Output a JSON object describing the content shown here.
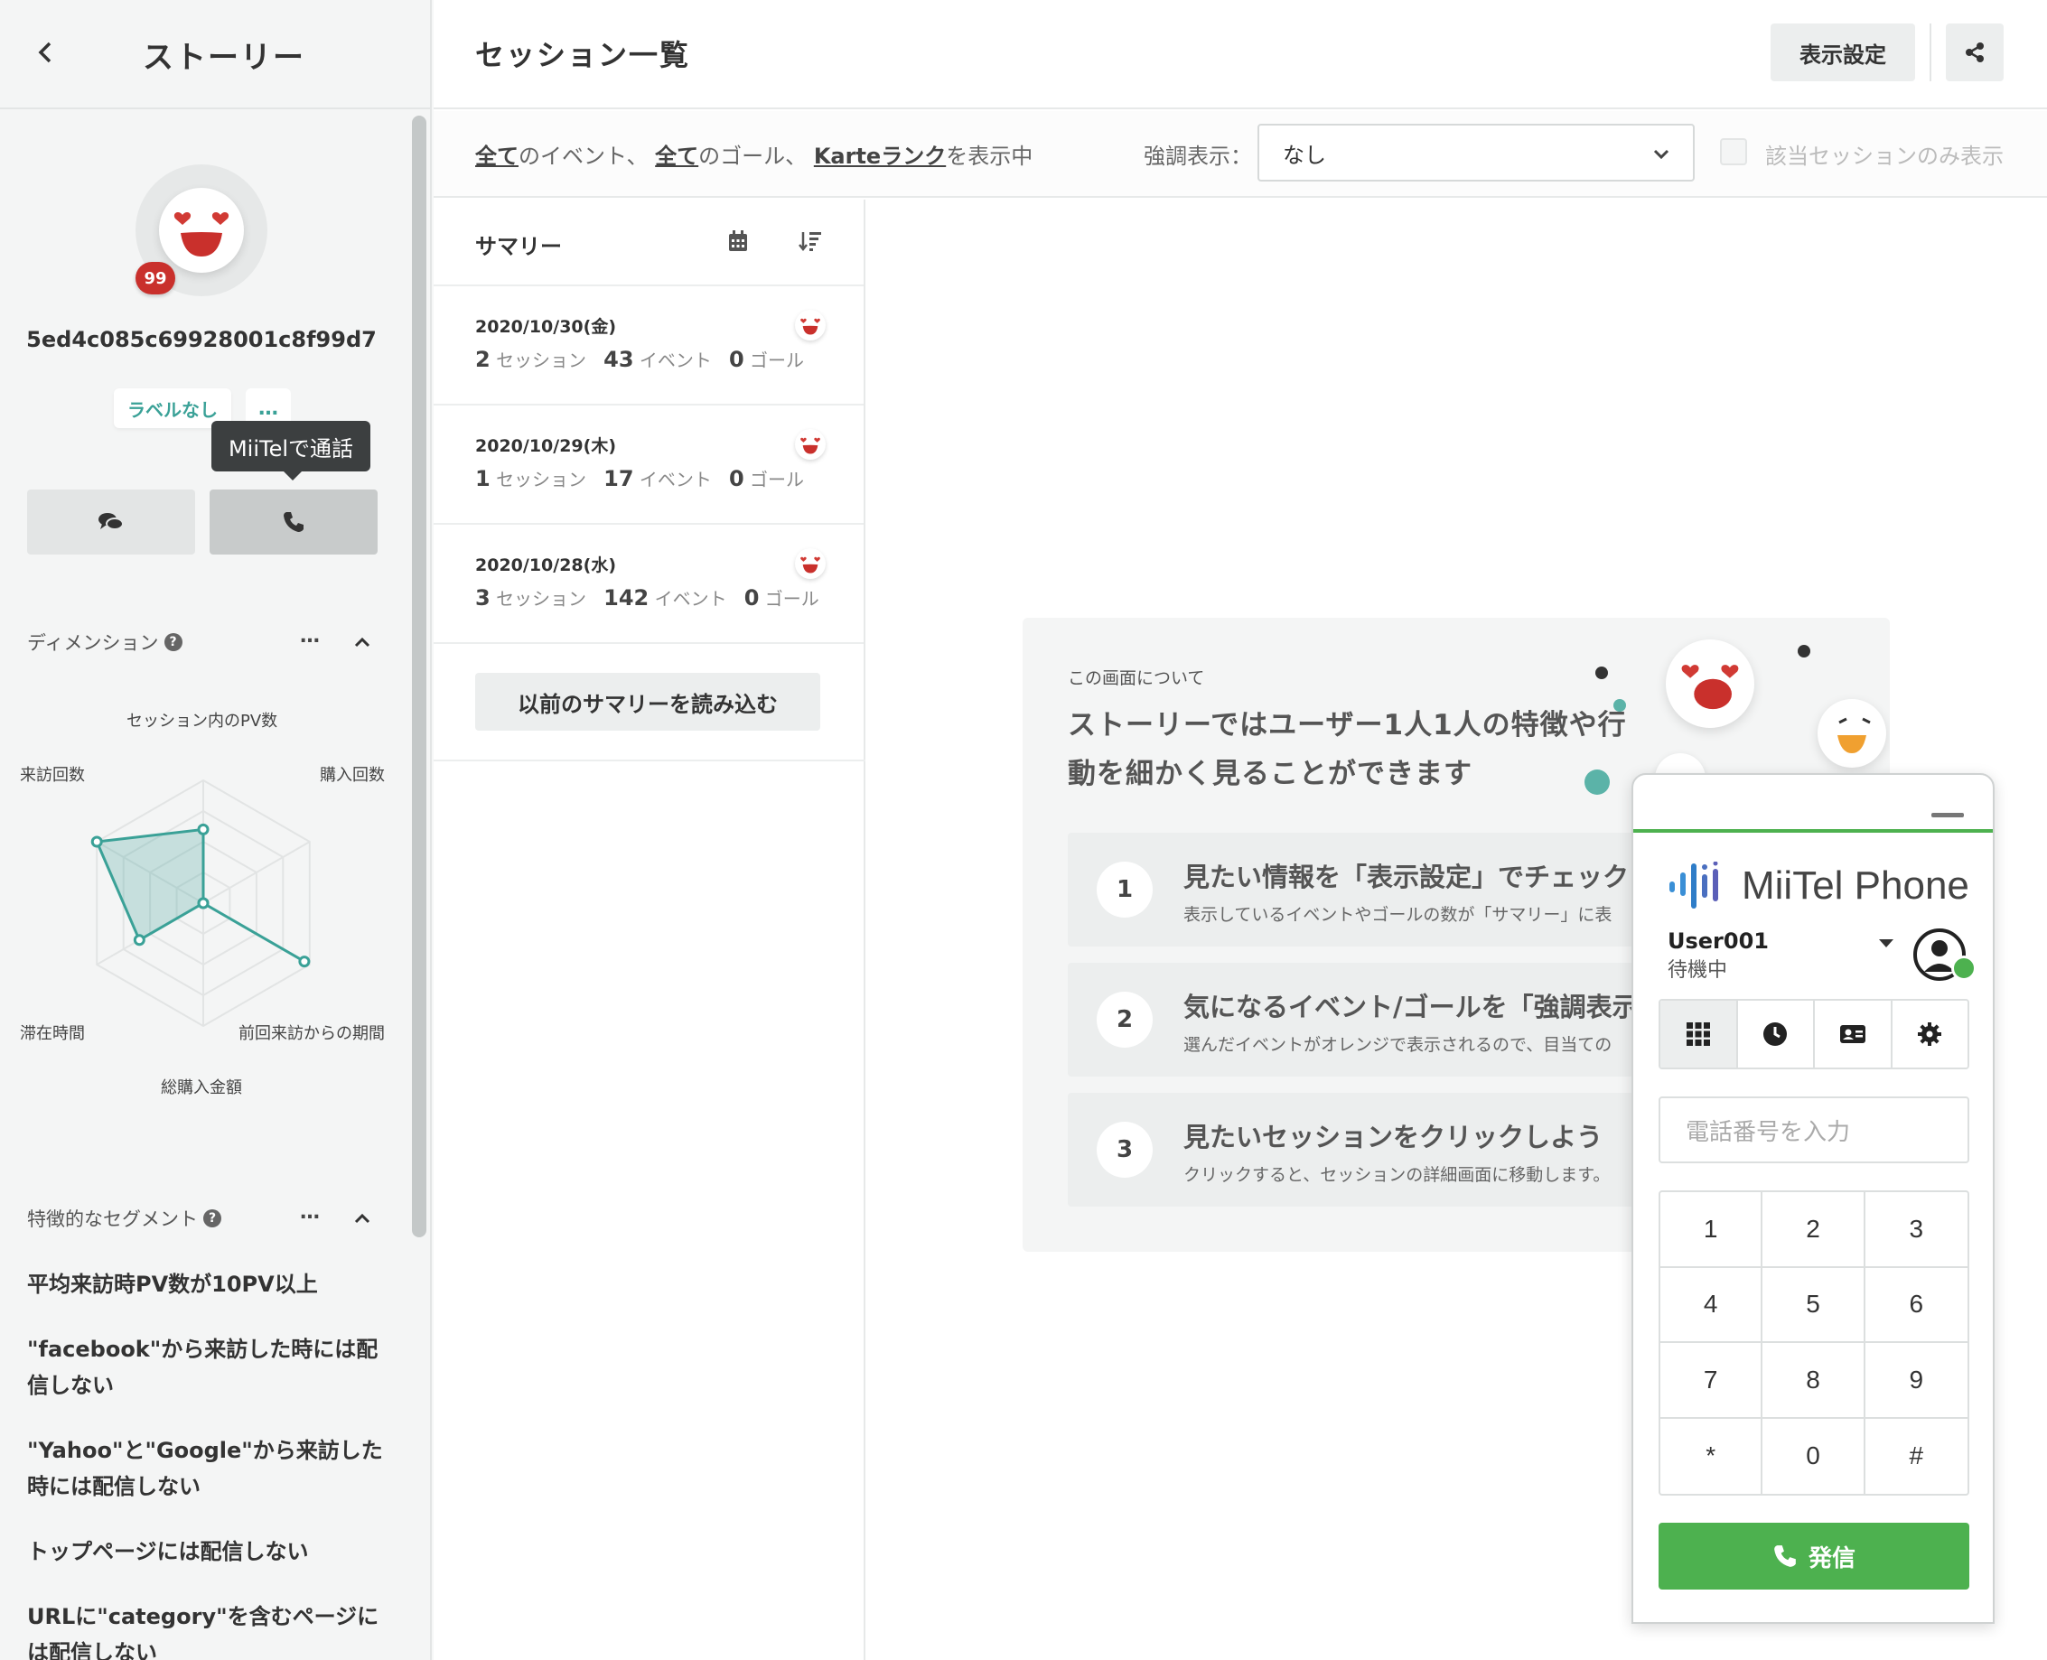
{
  "sidebar": {
    "title": "ストーリー",
    "badge_count": "99",
    "user_id": "5ed4c085c69928001c8f99d7",
    "label_chip": "ラベルなし",
    "more_chip": "…",
    "tooltip": "MiiTelで通話",
    "dimension": {
      "heading": "ディメンション",
      "menu": "…",
      "axes": {
        "top": "セッション内のPV数",
        "top_right": "購入回数",
        "bottom_right": "前回来訪からの期間",
        "bottom": "総購入金額",
        "bottom_left": "滞在時間",
        "top_left": "来訪回数"
      },
      "values": [
        0.6,
        0.0,
        0.95,
        0.0,
        0.6,
        1.0
      ]
    },
    "segments": {
      "heading": "特徴的なセグメント",
      "menu": "…",
      "items": [
        "平均来訪時PV数が10PV以上",
        "\"facebook\"から来訪した時には配信しない",
        "\"Yahoo\"と\"Google\"から来訪した時には配信しない",
        "トップページには配信しない",
        "URLに\"category\"を含むページには配信しない"
      ]
    }
  },
  "main": {
    "title": "セッション一覧",
    "display_settings": "表示設定",
    "filter": {
      "all1": "全て",
      "t1": "のイベント、",
      "all2": "全て",
      "t2": "のゴール、",
      "rank": "Karteランク",
      "t3": "を表示中"
    },
    "emphasis_label": "強調表示：",
    "emphasis_value": "なし",
    "only_matching": "該当セッションのみ表示"
  },
  "summary": {
    "title": "サマリー",
    "days": [
      {
        "date": "2020/10/30(金)",
        "sessions": "2",
        "events": "43",
        "goals": "0"
      },
      {
        "date": "2020/10/29(木)",
        "sessions": "1",
        "events": "17",
        "goals": "0"
      },
      {
        "date": "2020/10/28(水)",
        "sessions": "3",
        "events": "142",
        "goals": "0"
      }
    ],
    "session_unit": "セッション",
    "event_unit": "イベント",
    "goal_unit": "ゴール",
    "load_prev": "以前のサマリーを読み込む"
  },
  "about": {
    "sub": "この画面について",
    "title": "ストーリーではユーザー1人1人の特徴や行動を細かく見ることができます",
    "steps": [
      {
        "num": "1",
        "title": "見たい情報を「表示設定」でチェックし",
        "desc": "表示しているイベントやゴールの数が「サマリー」に表"
      },
      {
        "num": "2",
        "title": "気になるイベント/ゴールを「強調表示」",
        "desc": "選んだイベントがオレンジで表示されるので、目当ての"
      },
      {
        "num": "3",
        "title": "見たいセッションをクリックしよう",
        "desc": "クリックすると、セッションの詳細画面に移動します。"
      }
    ]
  },
  "phone": {
    "brand": "MiiTel Phone",
    "user": "User001",
    "status": "待機中",
    "placeholder": "電話番号を入力",
    "keys": [
      "1",
      "2",
      "3",
      "4",
      "5",
      "6",
      "7",
      "8",
      "9",
      "*",
      "0",
      "#"
    ],
    "call_label": "発信",
    "colors": {
      "green": "#4db14f"
    }
  },
  "colors": {
    "accent_teal": "#3aa197",
    "badge_red": "#c9302c"
  }
}
